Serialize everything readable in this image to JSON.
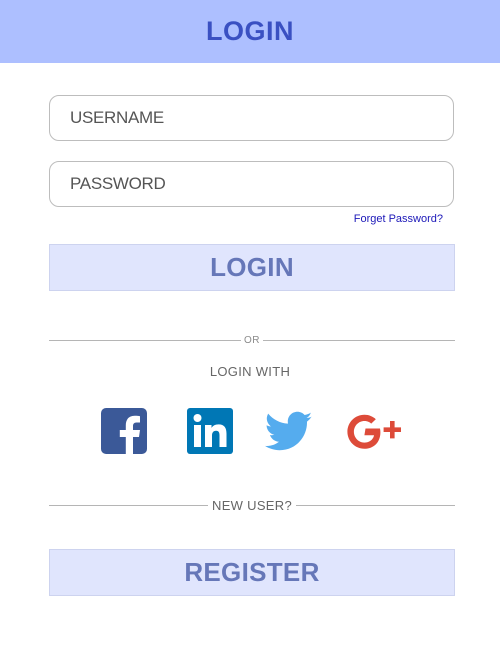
{
  "header": {
    "title": "LOGIN"
  },
  "form": {
    "username_placeholder": "USERNAME",
    "password_placeholder": "PASSWORD",
    "forgot_link": "Forget Password?",
    "login_button": "LOGIN"
  },
  "social": {
    "divider_text": "OR",
    "heading": "LOGIN WITH",
    "icons": [
      "facebook-icon",
      "linkedin-icon",
      "twitter-icon",
      "google-plus-icon"
    ]
  },
  "register": {
    "divider_text": "NEW USER?",
    "button": "REGISTER"
  },
  "colors": {
    "header_bg": "#adbfff",
    "header_text": "#3a50c2",
    "button_bg": "#e0e5fd",
    "button_text": "#6677b8",
    "link": "#1c18b8",
    "facebook": "#3b5998",
    "linkedin": "#0077b5",
    "twitter": "#55acee",
    "google": "#dd4b39"
  }
}
